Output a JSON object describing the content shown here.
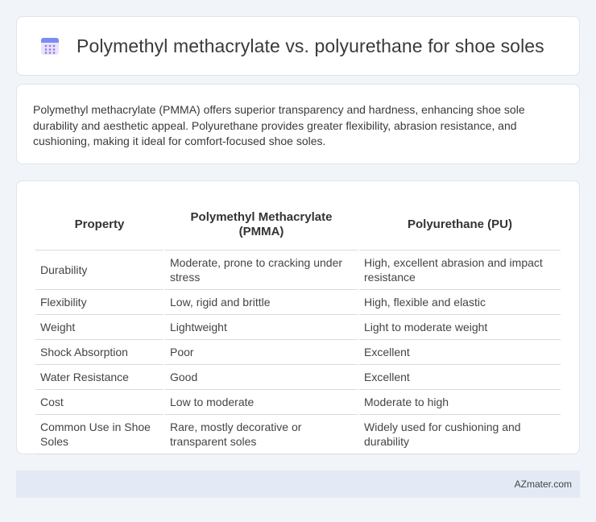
{
  "header": {
    "title": "Polymethyl methacrylate vs. polyurethane for shoe soles",
    "icon": "calendar-icon",
    "icon_colors": {
      "top": "#7b8cf0",
      "body": "#e9e4fb",
      "dots": "#9b7ee6"
    }
  },
  "summary": {
    "text": "Polymethyl methacrylate (PMMA) offers superior transparency and hardness, enhancing shoe sole durability and aesthetic appeal. Polyurethane provides greater flexibility, abrasion resistance, and cushioning, making it ideal for comfort-focused shoe soles."
  },
  "table": {
    "headers": [
      "Property",
      "Polymethyl Methacrylate (PMMA)",
      "Polyurethane (PU)"
    ],
    "rows": [
      [
        "Durability",
        "Moderate, prone to cracking under stress",
        "High, excellent abrasion and impact resistance"
      ],
      [
        "Flexibility",
        "Low, rigid and brittle",
        "High, flexible and elastic"
      ],
      [
        "Weight",
        "Lightweight",
        "Light to moderate weight"
      ],
      [
        "Shock Absorption",
        "Poor",
        "Excellent"
      ],
      [
        "Water Resistance",
        "Good",
        "Excellent"
      ],
      [
        "Cost",
        "Low to moderate",
        "Moderate to high"
      ],
      [
        "Common Use in Shoe Soles",
        "Rare, mostly decorative or transparent soles",
        "Widely used for cushioning and durability"
      ]
    ]
  },
  "footer": {
    "brand": "AZmater.com"
  }
}
